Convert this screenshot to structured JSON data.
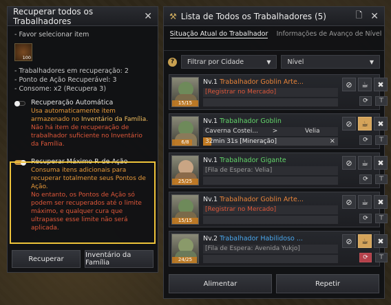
{
  "left": {
    "title": "Recuperar todos os Trabalhadores",
    "select_item": "- Favor selecionar item",
    "item_qty": "100",
    "stats": [
      "- Trabalhadores em recuperação: 2",
      "- Ponto de Ação Recuperável: 3",
      "- Consome: x2 (Recupera 3)"
    ],
    "auto": {
      "label": "Recuperação Automática",
      "desc1": "Usa automaticamente item armazenado no ",
      "desc1_strong": "Inventário da Família",
      "desc1_end": ".",
      "desc2": "Não há item de recuperação de trabalhador suficiente no Inventário da Família."
    },
    "max": {
      "label": "Recuperar Máximo P. de Ação",
      "desc1": "Consuma itens adicionais para recuperar totalmente seus Pontos de Ação.",
      "desc2": "No entanto, os Pontos de Ação só podem ser recuperados até o limite máximo, e qualquer cura que ultrapasse esse limite não será aplicada."
    },
    "buttons": {
      "recover": "Recuperar",
      "family_inventory": "Inventário da Família"
    }
  },
  "right": {
    "title": "Lista de Todos os Trabalhadores (5)",
    "tabs": [
      "Situação Atual do Trabalhador",
      "Informações de Avanço de Nível"
    ],
    "filter_city": "Filtrar por Cidade",
    "filter_level": "Nível",
    "workers": [
      {
        "level": "Nv.1",
        "name": "Trabalhador Goblin Arte...",
        "name_color": "#e8843a",
        "status": "[Registrar no Mercado]",
        "status_color": "#e0583a",
        "ap": "15/15",
        "ap_fill": 1.0,
        "face": "#6e8a5a",
        "body": "#7a6a4a"
      },
      {
        "level": "Nv.1",
        "name": "Trabalhador Goblin",
        "name_color": "#63d46a",
        "status": "Caverna Costei...",
        "status_arrow": ">",
        "status_dest": "Velia",
        "status_color": "#d8d8d8",
        "timer": "32min 31s [Mineração]",
        "timer_close": "×",
        "ap": "6/8",
        "ap_fill": 0.75,
        "face": "#6e8a5a",
        "body": "#8a7a5a"
      },
      {
        "level": "Nv.1",
        "name": "Trabalhador Gigante",
        "name_color": "#63d46a",
        "status": "[Fila de Espera: Velia]",
        "status_color": "#9a9a9a",
        "ap": "25/25",
        "ap_fill": 1.0,
        "face": "#c9a584",
        "body": "#8a6a4a"
      },
      {
        "level": "Nv.1",
        "name": "Trabalhador Goblin Arte...",
        "name_color": "#e8843a",
        "status": "[Registrar no Mercado]",
        "status_color": "#e0583a",
        "ap": "15/15",
        "ap_fill": 1.0,
        "face": "#6e8a5a",
        "body": "#7a6a4a"
      },
      {
        "level": "Nv.2",
        "name": "Trabalhador Habilidoso ...",
        "name_color": "#4aa8ee",
        "status": "[Fila de Espera: Avenida Yukjo]",
        "status_color": "#9a9a9a",
        "ap": "24/25",
        "ap_fill": 0.96,
        "face": "#8a9a6a",
        "body": "#6a7a5a"
      }
    ],
    "buttons": {
      "feed": "Alimentar",
      "repeat": "Repetir"
    }
  },
  "colors": {
    "highlight": "#f0c43a",
    "orange": "#e89a3a",
    "red": "#e0583a",
    "green": "#63d46a",
    "blue": "#4aa8ee"
  }
}
